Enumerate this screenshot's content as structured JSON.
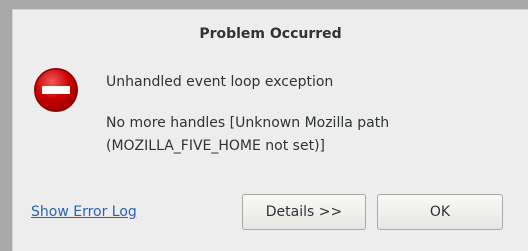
{
  "dialog": {
    "title": "Problem Occurred",
    "icon": "error-icon",
    "message": "Unhandled event loop exception",
    "detail_lines": [
      "No more handles [Unknown Mozilla path",
      "(MOZILLA_FIVE_HOME not set)]"
    ],
    "link_label": "Show Error Log",
    "buttons": {
      "details_label": "Details >>",
      "ok_label": "OK"
    }
  },
  "colors": {
    "dialog_bg": "#ededed",
    "icon_red": "#cc0000",
    "link": "#2a63b3",
    "text": "#2e3436"
  }
}
